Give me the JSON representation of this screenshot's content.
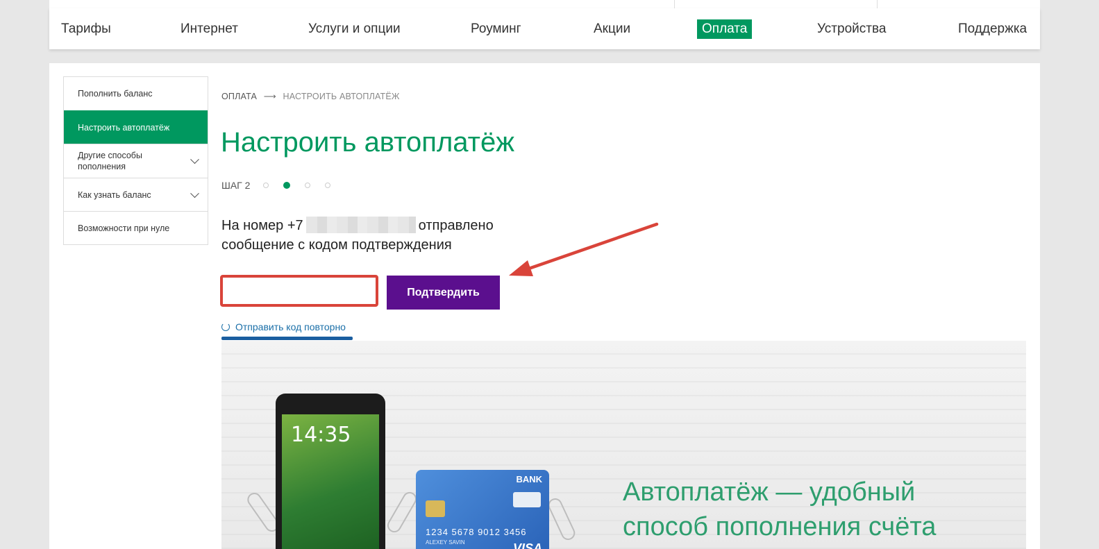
{
  "nav": {
    "items": [
      {
        "label": "Тарифы"
      },
      {
        "label": "Интернет"
      },
      {
        "label": "Услуги и опции"
      },
      {
        "label": "Роуминг"
      },
      {
        "label": "Акции"
      },
      {
        "label": "Оплата",
        "active": true
      },
      {
        "label": "Устройства"
      },
      {
        "label": "Поддержка"
      }
    ]
  },
  "sidebar": {
    "items": [
      {
        "label": "Пополнить баланс"
      },
      {
        "label": "Настроить автоплатёж",
        "active": true
      },
      {
        "label": "Другие способы пополнения",
        "expandable": true
      },
      {
        "label": "Как узнать баланс",
        "expandable": true
      },
      {
        "label": "Возможности при нуле"
      }
    ]
  },
  "breadcrumb": {
    "parent": "ОПЛАТА",
    "separator": "⟶",
    "current": "НАСТРОИТЬ АВТОПЛАТЁЖ"
  },
  "page": {
    "title": "Настроить автоплатёж",
    "step_label": "ШАГ 2",
    "step_current": 2,
    "step_total": 4,
    "message_prefix": "На номер +7",
    "message_suffix": "отправлено",
    "message_line2": "сообщение с кодом подтверждения"
  },
  "form": {
    "code_value": "",
    "confirm_label": "Подтвердить",
    "resend_label": "Отправить код повторно"
  },
  "banner": {
    "phone_time": "14:35",
    "card_bank": "BANK",
    "card_number": "1234  5678  9012  3456",
    "card_owner": "ALEXEY SAVIN",
    "card_brand": "VISA",
    "promo_line1": "Автоплатёж — удобный",
    "promo_line2": "способ пополнения счёта"
  },
  "colors": {
    "brand_green": "#00985f",
    "button_purple": "#5b0f8e",
    "annotation_red": "#d9443a",
    "link_blue": "#1a6fa8"
  }
}
